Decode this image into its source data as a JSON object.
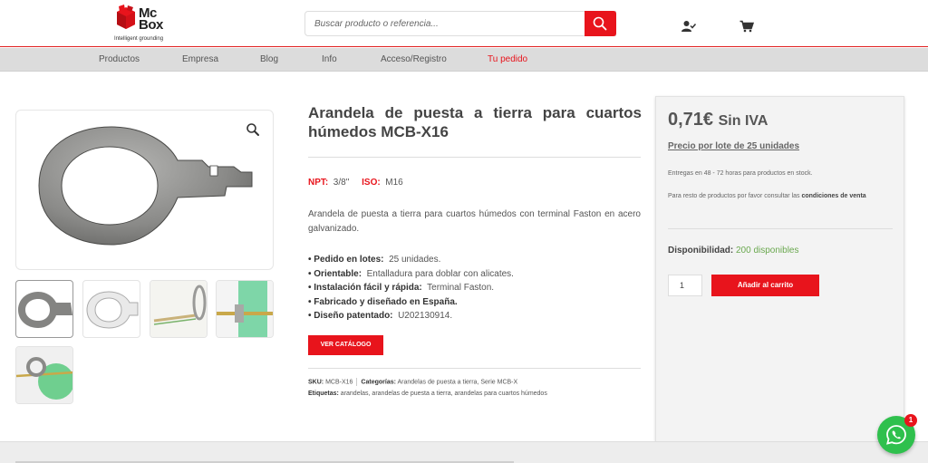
{
  "brand": {
    "line1": "Mc",
    "line2": "Box",
    "tagline": "Intelligent grounding",
    "color": "#e8141c"
  },
  "search": {
    "placeholder": "Buscar producto o referencia...",
    "button_icon": "search-icon"
  },
  "header_icons": [
    "user-check-icon",
    "cart-icon"
  ],
  "nav": {
    "items": [
      {
        "label": "Productos"
      },
      {
        "label": "Empresa"
      },
      {
        "label": "Blog"
      },
      {
        "label": "Info"
      },
      {
        "label": "Acceso/Registro"
      },
      {
        "label": "Tu pedido",
        "active": true
      }
    ]
  },
  "product": {
    "title": "Arandela de puesta a tierra para cuartos húmedos MCB-X16",
    "npt_label": "NPT:",
    "npt_value": "3/8\"",
    "iso_label": "ISO:",
    "iso_value": "M16",
    "description": "Arandela de puesta a tierra para cuartos húmedos con terminal Faston en acero galvanizado.",
    "features": [
      {
        "label": "• Pedido en lotes:",
        "value": "25 unidades."
      },
      {
        "label": "• Orientable:",
        "value": "Entalladura para doblar con alicates."
      },
      {
        "label": "• Instalación fácil y rápida:",
        "value": "Terminal Faston."
      },
      {
        "label": "• Fabricado y diseñado en España.",
        "value": ""
      },
      {
        "label": "• Diseño patentado:",
        "value": "U202130914."
      }
    ],
    "catalog_button": "VER CATÁLOGO",
    "sku_label": "SKU:",
    "sku": "MCB-X16",
    "categories_label": "Categorías:",
    "categories": "Arandelas de puesta a tierra, Serie MCB-X",
    "tags_label": "Etiquetas:",
    "tags": "arandelas, arandelas de puesta a tierra, arandelas para cuartos húmedos",
    "thumbnails": 5,
    "zoom_icon": "zoom-icon"
  },
  "buy": {
    "price": "0,71€",
    "tax": "Sin IVA",
    "lot": "Precio por lote de 25 unidades",
    "shipping": "Entregas en 48 - 72 horas para productos en stock.",
    "rest_text": "Para resto de productos por favor consultar las",
    "rest_link": "condiciones de venta",
    "availability_label": "Disponibilidad:",
    "availability_value": "200 disponibles",
    "quantity": "1",
    "add_button": "Añadir al carrito"
  },
  "whatsapp": {
    "badge": "1",
    "icon": "whatsapp-icon"
  }
}
